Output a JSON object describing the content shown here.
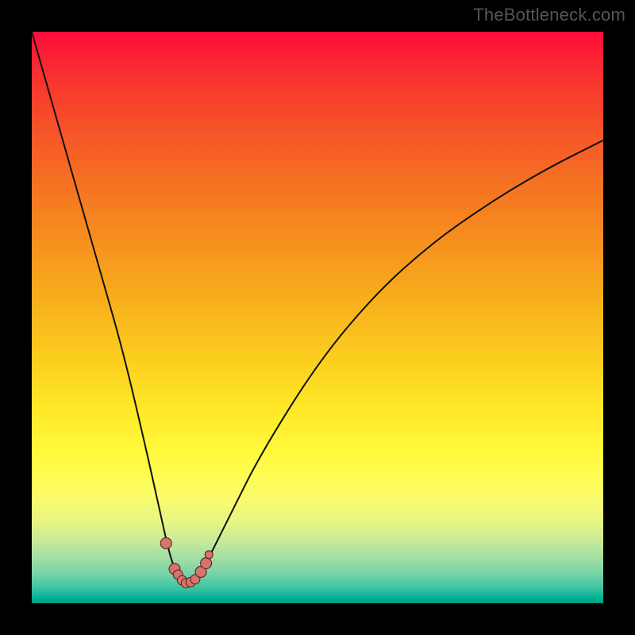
{
  "watermark": "TheBottleneck.com",
  "colors": {
    "frame": "#000000",
    "curve": "#111111",
    "marker_fill": "#d8736e",
    "marker_stroke": "#4a1f1c",
    "watermark": "#555555"
  },
  "chart_data": {
    "type": "line",
    "title": "",
    "xlabel": "",
    "ylabel": "",
    "xlim": [
      0,
      100
    ],
    "ylim": [
      0,
      100
    ],
    "grid": false,
    "legend": false,
    "description": "Single V-shaped bottleneck curve on a rainbow vertical gradient background. Y represents bottleneck severity (low=good/green, high=bad/red). Curve minimum near x≈27 at y≈3. No axis ticks or labels visible.",
    "series": [
      {
        "name": "bottleneck-curve",
        "x": [
          0,
          4,
          8,
          12,
          16,
          20,
          22,
          24,
          25,
          26,
          27,
          28,
          30,
          32,
          35,
          40,
          50,
          60,
          70,
          80,
          90,
          100
        ],
        "values": [
          100,
          86,
          72,
          58,
          44,
          27,
          18,
          9,
          6,
          4,
          3,
          4,
          6,
          10,
          16,
          26,
          42,
          54,
          63,
          70,
          76,
          81
        ]
      }
    ],
    "markers": {
      "name": "highlighted-points",
      "x": [
        23.5,
        25.0,
        25.6,
        26.3,
        27.0,
        27.8,
        28.6,
        29.6,
        30.5,
        31.0
      ],
      "values": [
        10.5,
        6.0,
        5.0,
        4.0,
        3.5,
        3.7,
        4.2,
        5.5,
        7.0,
        8.5
      ],
      "radius_px": [
        7,
        7,
        6,
        6,
        6,
        6,
        6,
        7,
        7,
        5
      ]
    }
  }
}
